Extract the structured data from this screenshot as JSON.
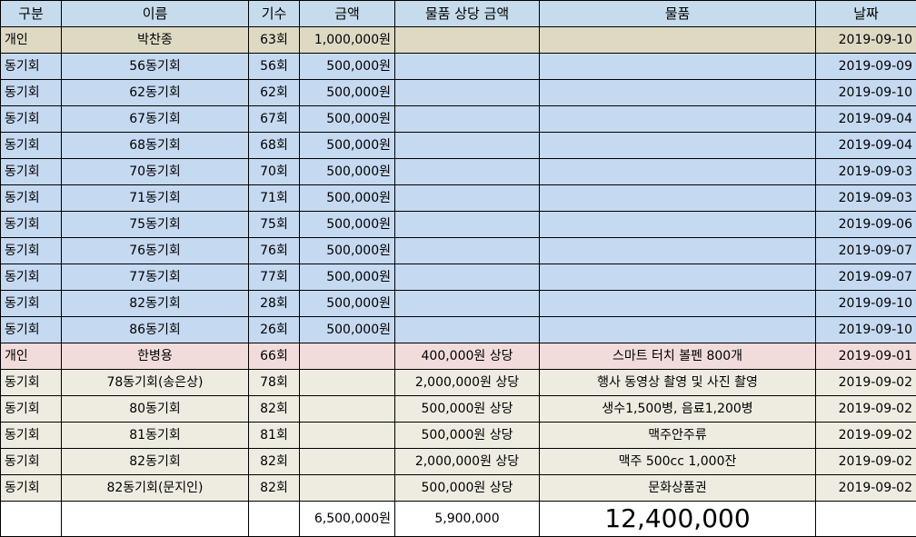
{
  "headers": [
    "구분",
    "이름",
    "기수",
    "금액",
    "물품 상당 금액",
    "물품",
    "날짜"
  ],
  "rows": [
    {
      "type": "개인",
      "name": "박찬종",
      "gen": "63회",
      "amount": "1,000,000원",
      "goods_value": "",
      "goods": "",
      "date": "2019-09-10",
      "style": "tan"
    },
    {
      "type": "동기회",
      "name": "56동기회",
      "gen": "56회",
      "amount": "500,000원",
      "goods_value": "",
      "goods": "",
      "date": "2019-09-09",
      "style": "blue"
    },
    {
      "type": "동기회",
      "name": "62동기회",
      "gen": "62회",
      "amount": "500,000원",
      "goods_value": "",
      "goods": "",
      "date": "2019-09-10",
      "style": "blue"
    },
    {
      "type": "동기회",
      "name": "67동기회",
      "gen": "67회",
      "amount": "500,000원",
      "goods_value": "",
      "goods": "",
      "date": "2019-09-04",
      "style": "blue"
    },
    {
      "type": "동기회",
      "name": "68동기회",
      "gen": "68회",
      "amount": "500,000원",
      "goods_value": "",
      "goods": "",
      "date": "2019-09-04",
      "style": "blue"
    },
    {
      "type": "동기회",
      "name": "70동기회",
      "gen": "70회",
      "amount": "500,000원",
      "goods_value": "",
      "goods": "",
      "date": "2019-09-03",
      "style": "blue"
    },
    {
      "type": "동기회",
      "name": "71동기회",
      "gen": "71회",
      "amount": "500,000원",
      "goods_value": "",
      "goods": "",
      "date": "2019-09-03",
      "style": "blue"
    },
    {
      "type": "동기회",
      "name": "75동기회",
      "gen": "75회",
      "amount": "500,000원",
      "goods_value": "",
      "goods": "",
      "date": "2019-09-06",
      "style": "blue"
    },
    {
      "type": "동기회",
      "name": "76동기회",
      "gen": "76회",
      "amount": "500,000원",
      "goods_value": "",
      "goods": "",
      "date": "2019-09-07",
      "style": "blue"
    },
    {
      "type": "동기회",
      "name": "77동기회",
      "gen": "77회",
      "amount": "500,000원",
      "goods_value": "",
      "goods": "",
      "date": "2019-09-07",
      "style": "blue"
    },
    {
      "type": "동기회",
      "name": "82동기회",
      "gen": "28회",
      "amount": "500,000원",
      "goods_value": "",
      "goods": "",
      "date": "2019-09-10",
      "style": "blue"
    },
    {
      "type": "동기회",
      "name": "86동기회",
      "gen": "26회",
      "amount": "500,000원",
      "goods_value": "",
      "goods": "",
      "date": "2019-09-10",
      "style": "blue"
    },
    {
      "type": "개인",
      "name": "한병용",
      "gen": "66회",
      "amount": "",
      "goods_value": "400,000원 상당",
      "goods": "스마트 터치 볼펜 800개",
      "date": "2019-09-01",
      "style": "pink"
    },
    {
      "type": "동기회",
      "name": "78동기회(송은상)",
      "gen": "78회",
      "amount": "",
      "goods_value": "2,000,000원 상당",
      "goods": "행사 동영상 촬영 및 사진 촬영",
      "date": "2019-09-02",
      "style": "beige"
    },
    {
      "type": "동기회",
      "name": "80동기회",
      "gen": "82회",
      "amount": "",
      "goods_value": "500,000원 상당",
      "goods": "생수1,500병, 음료1,200병",
      "date": "2019-09-02",
      "style": "beige"
    },
    {
      "type": "동기회",
      "name": "81동기회",
      "gen": "81회",
      "amount": "",
      "goods_value": "500,000원 상당",
      "goods": "맥주안주류",
      "date": "2019-09-02",
      "style": "beige"
    },
    {
      "type": "동기회",
      "name": "82동기회",
      "gen": "82회",
      "amount": "",
      "goods_value": "2,000,000원 상당",
      "goods": "맥주 500cc 1,000잔",
      "date": "2019-09-02",
      "style": "beige"
    },
    {
      "type": "동기회",
      "name": "82동기회(문지인)",
      "gen": "82회",
      "amount": "",
      "goods_value": "500,000원 상당",
      "goods": "문화상품권",
      "date": "2019-09-02",
      "style": "beige"
    }
  ],
  "totals": {
    "amount": "6,500,000원",
    "goods_value": "5,900,000",
    "grand": "12,400,000"
  }
}
